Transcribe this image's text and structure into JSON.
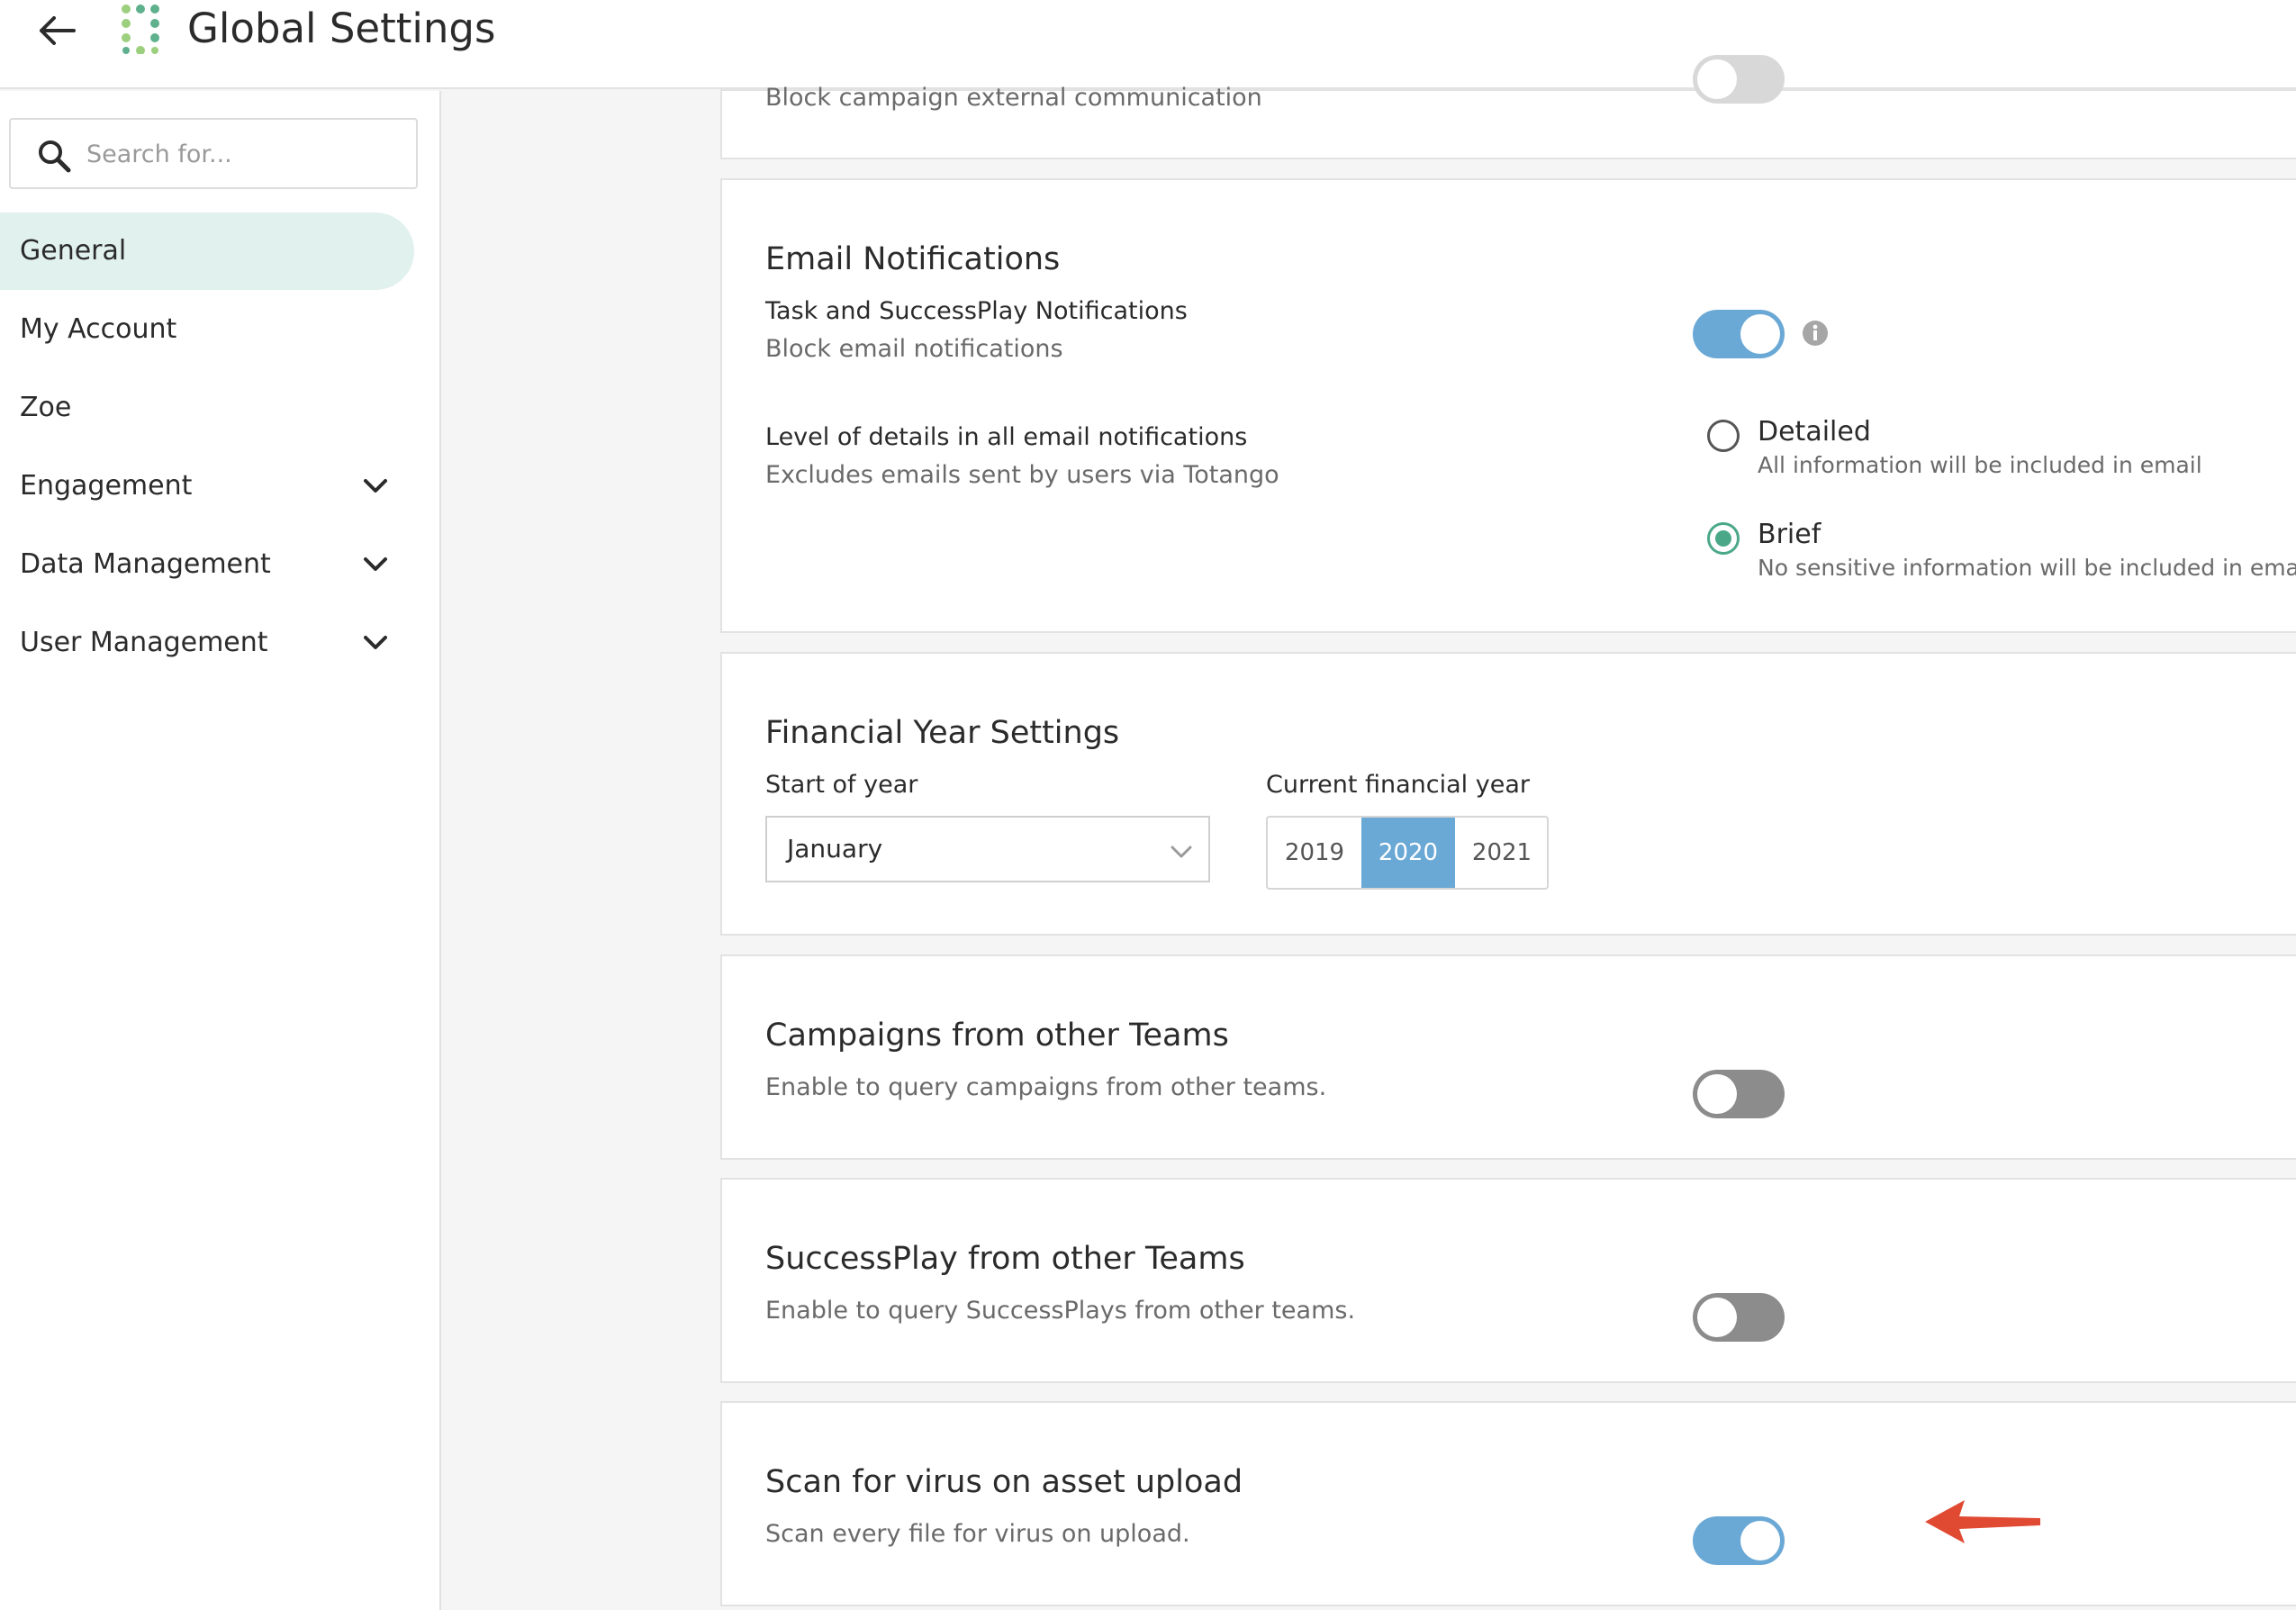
{
  "header": {
    "title": "Global Settings",
    "back_icon": "arrow-left-icon",
    "logo_icon": "dots-logo-icon"
  },
  "sidebar": {
    "search": {
      "placeholder": "Search for...",
      "value": ""
    },
    "items": [
      {
        "label": "General",
        "active": true
      },
      {
        "label": "My Account"
      },
      {
        "label": "Zoe"
      },
      {
        "label": "Engagement",
        "expandable": true
      },
      {
        "label": "Data Management",
        "expandable": true
      },
      {
        "label": "User Management",
        "expandable": true
      }
    ]
  },
  "cards": {
    "top_partial": {
      "subtitle": "Block campaign external communication"
    },
    "email": {
      "title": "Email Notifications",
      "task_label": "Task and SuccessPlay Notifications",
      "task_sub": "Block email notifications",
      "task_toggle": "on",
      "level_label": "Level of details in all email notifications",
      "level_sub": "Excludes emails sent by users via Totango",
      "options": [
        {
          "label": "Detailed",
          "sub": "All information will be included in email",
          "checked": false
        },
        {
          "label": "Brief",
          "sub": "No sensitive information will be included in email",
          "checked": true
        }
      ]
    },
    "financial": {
      "title": "Financial Year Settings",
      "start_label": "Start of year",
      "start_value": "January",
      "current_label": "Current financial year",
      "years": [
        "2019",
        "2020",
        "2021"
      ],
      "selected_year": "2020"
    },
    "campaigns": {
      "title": "Campaigns from other Teams",
      "sub": "Enable to query campaigns from other teams.",
      "toggle": "off"
    },
    "successplay": {
      "title": "SuccessPlay from other Teams",
      "sub": "Enable to query SuccessPlays from other teams.",
      "toggle": "off"
    },
    "virus": {
      "title": "Scan for virus on asset upload",
      "sub": "Scan every file for virus on upload.",
      "toggle": "on"
    }
  },
  "colors": {
    "accent_toggle": "#6aa8d6",
    "active_nav": "#e1f1ed",
    "radio_checked": "#4aa889",
    "annotation_arrow": "#e04a33"
  }
}
